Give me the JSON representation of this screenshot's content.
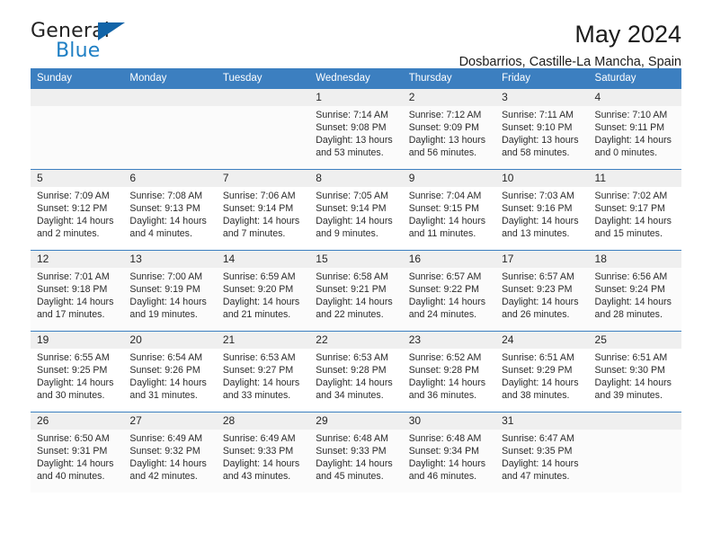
{
  "brand": {
    "name_part1": "General",
    "name_part2": "Blue",
    "triangle_color": "#1164a8",
    "blue_color": "#1f7fc4"
  },
  "header": {
    "title": "May 2024",
    "subtitle": "Dosbarrios, Castille-La Mancha, Spain"
  },
  "theme": {
    "header_bg": "#3c7fc0",
    "daynum_bg": "#efefef",
    "alt_row_bg": "#fbfbfb"
  },
  "weekday_headers": [
    "Sunday",
    "Monday",
    "Tuesday",
    "Wednesday",
    "Thursday",
    "Friday",
    "Saturday"
  ],
  "weeks": [
    [
      {
        "day": "",
        "sunrise": "",
        "sunset": "",
        "daylight1": "",
        "daylight2": ""
      },
      {
        "day": "",
        "sunrise": "",
        "sunset": "",
        "daylight1": "",
        "daylight2": ""
      },
      {
        "day": "",
        "sunrise": "",
        "sunset": "",
        "daylight1": "",
        "daylight2": ""
      },
      {
        "day": "1",
        "sunrise": "Sunrise: 7:14 AM",
        "sunset": "Sunset: 9:08 PM",
        "daylight1": "Daylight: 13 hours",
        "daylight2": "and 53 minutes."
      },
      {
        "day": "2",
        "sunrise": "Sunrise: 7:12 AM",
        "sunset": "Sunset: 9:09 PM",
        "daylight1": "Daylight: 13 hours",
        "daylight2": "and 56 minutes."
      },
      {
        "day": "3",
        "sunrise": "Sunrise: 7:11 AM",
        "sunset": "Sunset: 9:10 PM",
        "daylight1": "Daylight: 13 hours",
        "daylight2": "and 58 minutes."
      },
      {
        "day": "4",
        "sunrise": "Sunrise: 7:10 AM",
        "sunset": "Sunset: 9:11 PM",
        "daylight1": "Daylight: 14 hours",
        "daylight2": "and 0 minutes."
      }
    ],
    [
      {
        "day": "5",
        "sunrise": "Sunrise: 7:09 AM",
        "sunset": "Sunset: 9:12 PM",
        "daylight1": "Daylight: 14 hours",
        "daylight2": "and 2 minutes."
      },
      {
        "day": "6",
        "sunrise": "Sunrise: 7:08 AM",
        "sunset": "Sunset: 9:13 PM",
        "daylight1": "Daylight: 14 hours",
        "daylight2": "and 4 minutes."
      },
      {
        "day": "7",
        "sunrise": "Sunrise: 7:06 AM",
        "sunset": "Sunset: 9:14 PM",
        "daylight1": "Daylight: 14 hours",
        "daylight2": "and 7 minutes."
      },
      {
        "day": "8",
        "sunrise": "Sunrise: 7:05 AM",
        "sunset": "Sunset: 9:14 PM",
        "daylight1": "Daylight: 14 hours",
        "daylight2": "and 9 minutes."
      },
      {
        "day": "9",
        "sunrise": "Sunrise: 7:04 AM",
        "sunset": "Sunset: 9:15 PM",
        "daylight1": "Daylight: 14 hours",
        "daylight2": "and 11 minutes."
      },
      {
        "day": "10",
        "sunrise": "Sunrise: 7:03 AM",
        "sunset": "Sunset: 9:16 PM",
        "daylight1": "Daylight: 14 hours",
        "daylight2": "and 13 minutes."
      },
      {
        "day": "11",
        "sunrise": "Sunrise: 7:02 AM",
        "sunset": "Sunset: 9:17 PM",
        "daylight1": "Daylight: 14 hours",
        "daylight2": "and 15 minutes."
      }
    ],
    [
      {
        "day": "12",
        "sunrise": "Sunrise: 7:01 AM",
        "sunset": "Sunset: 9:18 PM",
        "daylight1": "Daylight: 14 hours",
        "daylight2": "and 17 minutes."
      },
      {
        "day": "13",
        "sunrise": "Sunrise: 7:00 AM",
        "sunset": "Sunset: 9:19 PM",
        "daylight1": "Daylight: 14 hours",
        "daylight2": "and 19 minutes."
      },
      {
        "day": "14",
        "sunrise": "Sunrise: 6:59 AM",
        "sunset": "Sunset: 9:20 PM",
        "daylight1": "Daylight: 14 hours",
        "daylight2": "and 21 minutes."
      },
      {
        "day": "15",
        "sunrise": "Sunrise: 6:58 AM",
        "sunset": "Sunset: 9:21 PM",
        "daylight1": "Daylight: 14 hours",
        "daylight2": "and 22 minutes."
      },
      {
        "day": "16",
        "sunrise": "Sunrise: 6:57 AM",
        "sunset": "Sunset: 9:22 PM",
        "daylight1": "Daylight: 14 hours",
        "daylight2": "and 24 minutes."
      },
      {
        "day": "17",
        "sunrise": "Sunrise: 6:57 AM",
        "sunset": "Sunset: 9:23 PM",
        "daylight1": "Daylight: 14 hours",
        "daylight2": "and 26 minutes."
      },
      {
        "day": "18",
        "sunrise": "Sunrise: 6:56 AM",
        "sunset": "Sunset: 9:24 PM",
        "daylight1": "Daylight: 14 hours",
        "daylight2": "and 28 minutes."
      }
    ],
    [
      {
        "day": "19",
        "sunrise": "Sunrise: 6:55 AM",
        "sunset": "Sunset: 9:25 PM",
        "daylight1": "Daylight: 14 hours",
        "daylight2": "and 30 minutes."
      },
      {
        "day": "20",
        "sunrise": "Sunrise: 6:54 AM",
        "sunset": "Sunset: 9:26 PM",
        "daylight1": "Daylight: 14 hours",
        "daylight2": "and 31 minutes."
      },
      {
        "day": "21",
        "sunrise": "Sunrise: 6:53 AM",
        "sunset": "Sunset: 9:27 PM",
        "daylight1": "Daylight: 14 hours",
        "daylight2": "and 33 minutes."
      },
      {
        "day": "22",
        "sunrise": "Sunrise: 6:53 AM",
        "sunset": "Sunset: 9:28 PM",
        "daylight1": "Daylight: 14 hours",
        "daylight2": "and 34 minutes."
      },
      {
        "day": "23",
        "sunrise": "Sunrise: 6:52 AM",
        "sunset": "Sunset: 9:28 PM",
        "daylight1": "Daylight: 14 hours",
        "daylight2": "and 36 minutes."
      },
      {
        "day": "24",
        "sunrise": "Sunrise: 6:51 AM",
        "sunset": "Sunset: 9:29 PM",
        "daylight1": "Daylight: 14 hours",
        "daylight2": "and 38 minutes."
      },
      {
        "day": "25",
        "sunrise": "Sunrise: 6:51 AM",
        "sunset": "Sunset: 9:30 PM",
        "daylight1": "Daylight: 14 hours",
        "daylight2": "and 39 minutes."
      }
    ],
    [
      {
        "day": "26",
        "sunrise": "Sunrise: 6:50 AM",
        "sunset": "Sunset: 9:31 PM",
        "daylight1": "Daylight: 14 hours",
        "daylight2": "and 40 minutes."
      },
      {
        "day": "27",
        "sunrise": "Sunrise: 6:49 AM",
        "sunset": "Sunset: 9:32 PM",
        "daylight1": "Daylight: 14 hours",
        "daylight2": "and 42 minutes."
      },
      {
        "day": "28",
        "sunrise": "Sunrise: 6:49 AM",
        "sunset": "Sunset: 9:33 PM",
        "daylight1": "Daylight: 14 hours",
        "daylight2": "and 43 minutes."
      },
      {
        "day": "29",
        "sunrise": "Sunrise: 6:48 AM",
        "sunset": "Sunset: 9:33 PM",
        "daylight1": "Daylight: 14 hours",
        "daylight2": "and 45 minutes."
      },
      {
        "day": "30",
        "sunrise": "Sunrise: 6:48 AM",
        "sunset": "Sunset: 9:34 PM",
        "daylight1": "Daylight: 14 hours",
        "daylight2": "and 46 minutes."
      },
      {
        "day": "31",
        "sunrise": "Sunrise: 6:47 AM",
        "sunset": "Sunset: 9:35 PM",
        "daylight1": "Daylight: 14 hours",
        "daylight2": "and 47 minutes."
      },
      {
        "day": "",
        "sunrise": "",
        "sunset": "",
        "daylight1": "",
        "daylight2": ""
      }
    ]
  ]
}
